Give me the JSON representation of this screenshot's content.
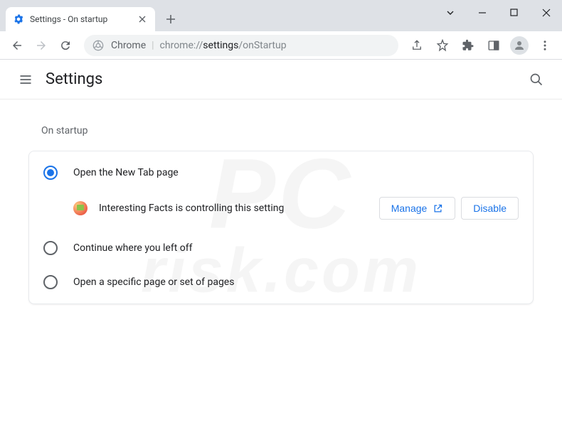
{
  "window": {
    "tab_title": "Settings - On startup"
  },
  "omnibox": {
    "scheme_label": "Chrome",
    "url_scheme": "chrome://",
    "url_path_bold": "settings",
    "url_path_rest": "/onStartup"
  },
  "settings": {
    "header_title": "Settings",
    "section_title": "On startup",
    "options": [
      {
        "label": "Open the New Tab page",
        "selected": true
      },
      {
        "label": "Continue where you left off",
        "selected": false
      },
      {
        "label": "Open a specific page or set of pages",
        "selected": false
      }
    ],
    "controlled_notice": "Interesting Facts is controlling this setting",
    "manage_label": "Manage",
    "disable_label": "Disable"
  },
  "watermark": {
    "line1": "PC",
    "line2": "risk.com"
  }
}
